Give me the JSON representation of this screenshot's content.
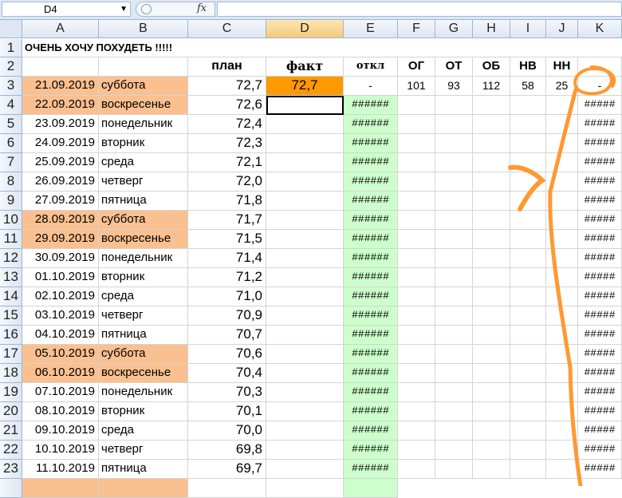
{
  "formula_bar": {
    "namebox": "D4",
    "fx_label": "fx",
    "formula": ""
  },
  "columns": [
    "A",
    "B",
    "C",
    "D",
    "E",
    "F",
    "G",
    "H",
    "I",
    "J",
    "K"
  ],
  "title": "ОЧЕНЬ ХОЧУ ПОХУДЕТЬ !!!!!",
  "headers": {
    "plan": "план",
    "fact": "факт",
    "otkl": "откл",
    "og": "ОГ",
    "ot": "ОТ",
    "ob": "ОБ",
    "nv": "НВ",
    "nn": "НН"
  },
  "row3_extra": {
    "fact": "72,7",
    "otkl": "-",
    "og": "101",
    "ot": "93",
    "ob": "112",
    "nv": "58",
    "nn": "25",
    "k": "-"
  },
  "rows": [
    {
      "num": "3",
      "date": "21.09.2019",
      "day": "суббота",
      "plan": "72,7",
      "e": "",
      "k": "",
      "weekend": true
    },
    {
      "num": "4",
      "date": "22.09.2019",
      "day": "воскресенье",
      "plan": "72,6",
      "e": "######",
      "k": "#####",
      "weekend": true
    },
    {
      "num": "5",
      "date": "23.09.2019",
      "day": "понедельник",
      "plan": "72,4",
      "e": "######",
      "k": "#####",
      "weekend": false
    },
    {
      "num": "6",
      "date": "24.09.2019",
      "day": "вторник",
      "plan": "72,3",
      "e": "######",
      "k": "#####",
      "weekend": false
    },
    {
      "num": "7",
      "date": "25.09.2019",
      "day": "среда",
      "plan": "72,1",
      "e": "######",
      "k": "#####",
      "weekend": false
    },
    {
      "num": "8",
      "date": "26.09.2019",
      "day": "четверг",
      "plan": "72,0",
      "e": "######",
      "k": "#####",
      "weekend": false
    },
    {
      "num": "9",
      "date": "27.09.2019",
      "day": "пятница",
      "plan": "71,8",
      "e": "######",
      "k": "#####",
      "weekend": false
    },
    {
      "num": "10",
      "date": "28.09.2019",
      "day": "суббота",
      "plan": "71,7",
      "e": "######",
      "k": "#####",
      "weekend": true
    },
    {
      "num": "11",
      "date": "29.09.2019",
      "day": "воскресенье",
      "plan": "71,5",
      "e": "######",
      "k": "#####",
      "weekend": true
    },
    {
      "num": "12",
      "date": "30.09.2019",
      "day": "понедельник",
      "plan": "71,4",
      "e": "######",
      "k": "#####",
      "weekend": false
    },
    {
      "num": "13",
      "date": "01.10.2019",
      "day": "вторник",
      "plan": "71,2",
      "e": "######",
      "k": "#####",
      "weekend": false
    },
    {
      "num": "14",
      "date": "02.10.2019",
      "day": "среда",
      "plan": "71,0",
      "e": "######",
      "k": "#####",
      "weekend": false
    },
    {
      "num": "15",
      "date": "03.10.2019",
      "day": "четверг",
      "plan": "70,9",
      "e": "######",
      "k": "#####",
      "weekend": false
    },
    {
      "num": "16",
      "date": "04.10.2019",
      "day": "пятница",
      "plan": "70,7",
      "e": "######",
      "k": "#####",
      "weekend": false
    },
    {
      "num": "17",
      "date": "05.10.2019",
      "day": "суббота",
      "plan": "70,6",
      "e": "######",
      "k": "#####",
      "weekend": true
    },
    {
      "num": "18",
      "date": "06.10.2019",
      "day": "воскресенье",
      "plan": "70,4",
      "e": "######",
      "k": "#####",
      "weekend": true
    },
    {
      "num": "19",
      "date": "07.10.2019",
      "day": "понедельник",
      "plan": "70,3",
      "e": "######",
      "k": "#####",
      "weekend": false
    },
    {
      "num": "20",
      "date": "08.10.2019",
      "day": "вторник",
      "plan": "70,1",
      "e": "######",
      "k": "#####",
      "weekend": false
    },
    {
      "num": "21",
      "date": "09.10.2019",
      "day": "среда",
      "plan": "70,0",
      "e": "######",
      "k": "#####",
      "weekend": false
    },
    {
      "num": "22",
      "date": "10.10.2019",
      "day": "четверг",
      "plan": "69,8",
      "e": "######",
      "k": "#####",
      "weekend": false
    },
    {
      "num": "23",
      "date": "11.10.2019",
      "day": "пятница",
      "plan": "69,7",
      "e": "######",
      "k": "#####",
      "weekend": false
    }
  ],
  "annotation_text": "7",
  "colors": {
    "weekend": "#fac090",
    "deviation": "#ccffcc",
    "fact_fill": "#ff9900",
    "annotation": "#ff9933"
  }
}
